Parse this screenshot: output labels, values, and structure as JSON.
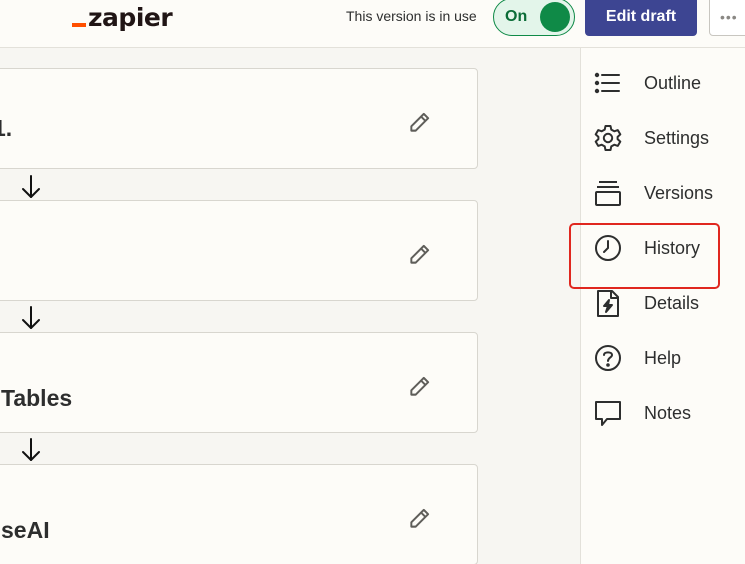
{
  "header": {
    "logo_text": "zapier",
    "version_status": "This version is in use",
    "toggle_label": "On",
    "edit_draft_label": "Edit draft",
    "more_label": "•••"
  },
  "steps": [
    {
      "title": "1."
    },
    {
      "title": ""
    },
    {
      "title": "Tables"
    },
    {
      "title": "seAI"
    }
  ],
  "sidebar": {
    "items": [
      {
        "label": "Outline",
        "icon": "list-icon"
      },
      {
        "label": "Settings",
        "icon": "gear-icon"
      },
      {
        "label": "Versions",
        "icon": "versions-icon"
      },
      {
        "label": "History",
        "icon": "clock-icon"
      },
      {
        "label": "Details",
        "icon": "lightning-file-icon"
      },
      {
        "label": "Help",
        "icon": "question-icon"
      },
      {
        "label": "Notes",
        "icon": "comment-icon"
      }
    ]
  },
  "colors": {
    "brand_orange": "#ff4f00",
    "toggle_green": "#0f8a47",
    "primary_button": "#3d4592",
    "highlight_red": "#e0271f"
  }
}
